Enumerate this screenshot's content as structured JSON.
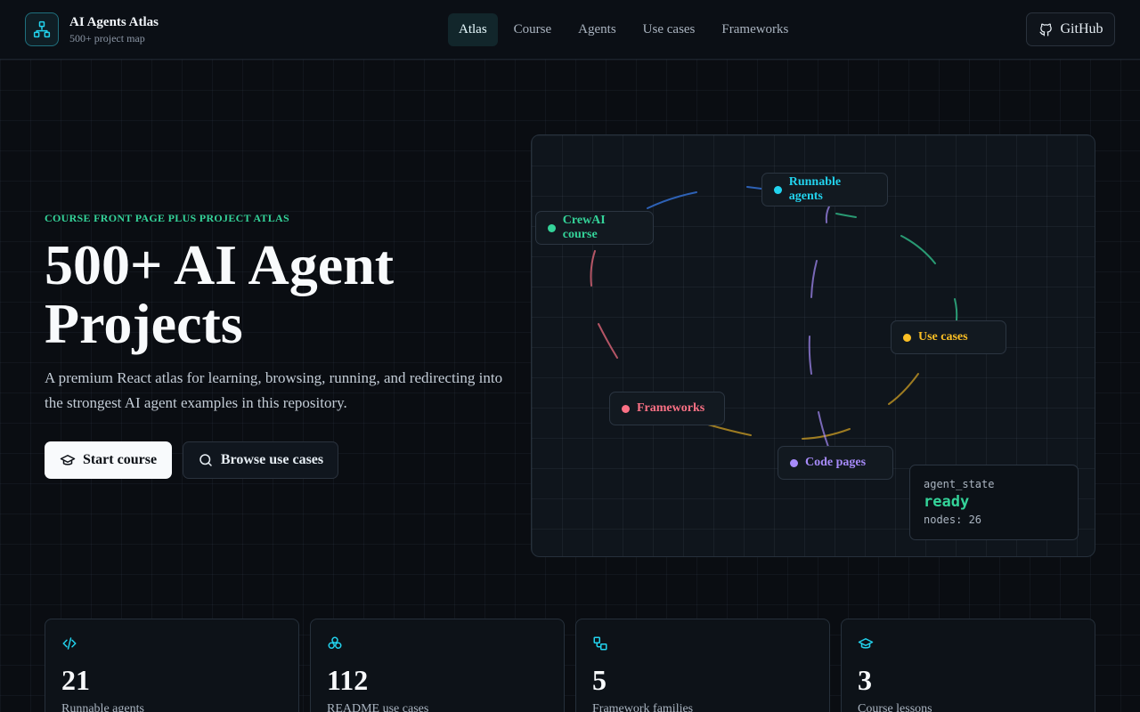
{
  "brand": {
    "title": "AI Agents Atlas",
    "subtitle": "500+ project map"
  },
  "nav": [
    "Atlas",
    "Course",
    "Agents",
    "Use cases",
    "Frameworks"
  ],
  "nav_active": "Atlas",
  "github_label": "GitHub",
  "hero": {
    "eyebrow": "COURSE FRONT PAGE PLUS PROJECT ATLAS",
    "title": "500+ AI Agent Projects",
    "description": "A premium React atlas for learning, browsing, running, and redirecting into the strongest AI agent examples in this repository.",
    "primary_button": "Start course",
    "secondary_button": "Browse use cases"
  },
  "atlas": {
    "nodes": [
      {
        "label": "Runnable agents",
        "color": "#22d3ee"
      },
      {
        "label": "CrewAI course",
        "color": "#34d399"
      },
      {
        "label": "Use cases",
        "color": "#fbbf24"
      },
      {
        "label": "Frameworks",
        "color": "#fb7185"
      },
      {
        "label": "Code pages",
        "color": "#a78bfa"
      }
    ],
    "state": {
      "key": "agent_state",
      "value": "ready",
      "nodes": "nodes: 26"
    }
  },
  "stats": [
    {
      "value": "21",
      "label": "Runnable agents",
      "icon": "code-icon"
    },
    {
      "value": "112",
      "label": "README use cases",
      "icon": "boxes-icon"
    },
    {
      "value": "5",
      "label": "Framework families",
      "icon": "workflow-icon"
    },
    {
      "value": "3",
      "label": "Course lessons",
      "icon": "graduation-cap-icon"
    }
  ],
  "colors": {
    "accent": "#22d3ee",
    "green": "#34d399",
    "amber": "#fbbf24",
    "rose": "#fb7185",
    "violet": "#a78bfa"
  }
}
